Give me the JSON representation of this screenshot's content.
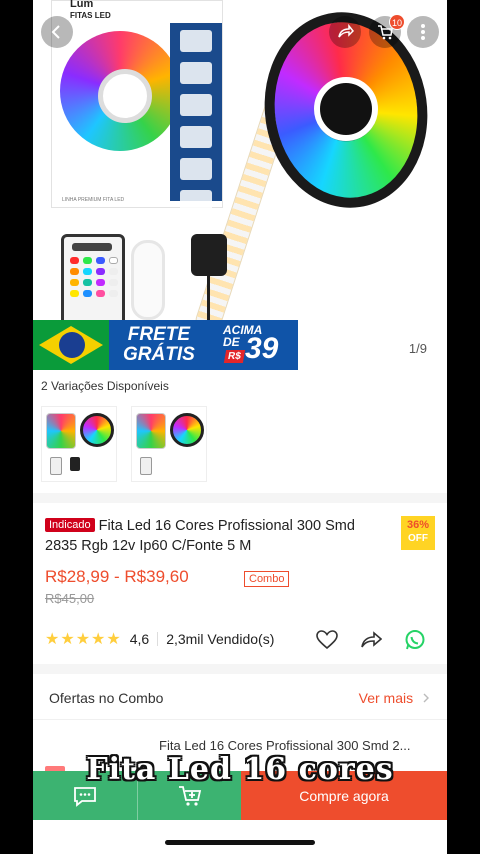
{
  "header": {
    "cart_count": "10",
    "back_icon": "back-arrow-icon",
    "share_icon": "share-icon",
    "cart_icon": "cart-icon",
    "more_icon": "more-icon"
  },
  "product_image": {
    "box_brand": "Lum",
    "box_subtitle": "FITAS LED",
    "box_footer": "LINHA PREMIUM FITA LED",
    "image_counter": "1/9"
  },
  "promo_banner": {
    "frete_line1": "FRETE",
    "frete_line2": "GRÁTIS",
    "acima_line1": "ACIMA",
    "acima_line2": "DE",
    "currency": "R$",
    "amount": "39"
  },
  "variations": {
    "label": "2 Variações Disponíveis"
  },
  "product": {
    "badge": "Indicado",
    "title": "Fita Led 16 Cores Profissional 300 Smd 2835 Rgb 12v Ip60 C/Fonte 5 M",
    "discount": "36%",
    "discount_label": "OFF",
    "price_range": "R$28,99 - R$39,60",
    "combo_tag": "Combo",
    "old_price": "R$45,00",
    "rating": "4,6",
    "sold": "2,3mil Vendido(s)"
  },
  "offers": {
    "label": "Ofertas no Combo",
    "more": "Ver mais",
    "item_title": "Fita Led 16 Cores Profissional 300 Smd 2..."
  },
  "bottom_bar": {
    "buy_label": "Compre agora"
  },
  "caption": "Fita Led 16 cores",
  "colors": {
    "accent": "#ee4d2d",
    "chat_bar": "#3cb371",
    "promo_blue": "#1054a8",
    "star": "#ffce3d"
  }
}
